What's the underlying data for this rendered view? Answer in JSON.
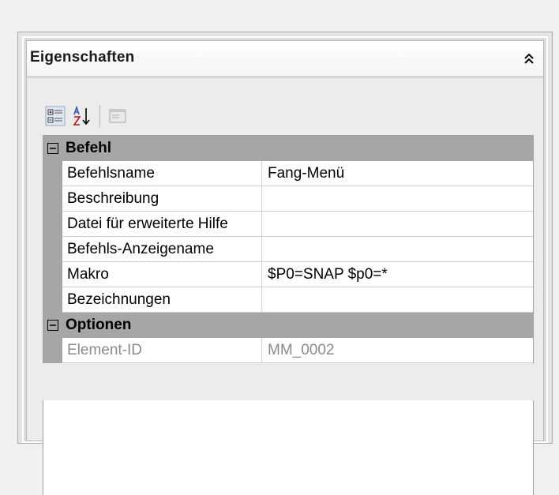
{
  "panel": {
    "title": "Eigenschaften",
    "collapse_icon": "double-chevron-up-icon"
  },
  "toolbar": {
    "buttons": [
      {
        "icon": "categorized-icon"
      },
      {
        "icon": "sort-alphabetical-icon"
      },
      {
        "icon": "property-pages-icon"
      }
    ]
  },
  "grid": {
    "categories": [
      {
        "label": "Befehl",
        "expanded": true,
        "rows": [
          {
            "name": "Befehlsname",
            "value": "Fang-Menü"
          },
          {
            "name": "Beschreibung",
            "value": ""
          },
          {
            "name": "Datei für erweiterte Hilfe",
            "value": ""
          },
          {
            "name": "Befehls-Anzeigename",
            "value": ""
          },
          {
            "name": "Makro",
            "value": "$P0=SNAP $p0=*"
          },
          {
            "name": "Bezeichnungen",
            "value": ""
          }
        ]
      },
      {
        "label": "Optionen",
        "expanded": true,
        "rows": [
          {
            "name": "Element-ID",
            "value": "MM_0002"
          }
        ]
      }
    ]
  }
}
